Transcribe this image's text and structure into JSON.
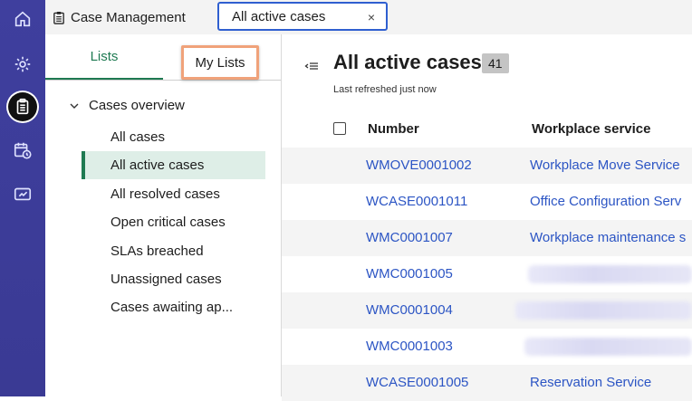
{
  "rail": {
    "items": [
      {
        "name": "home-icon"
      },
      {
        "name": "settings-icon"
      },
      {
        "name": "clipboard-icon",
        "active": true
      },
      {
        "name": "calendar-clock-icon"
      },
      {
        "name": "dashboard-icon"
      }
    ]
  },
  "tabs": {
    "app_label": "Case Management",
    "active_tab_label": "All active cases",
    "close_glyph": "×"
  },
  "sidebar": {
    "tab_lists": "Lists",
    "tab_my_lists": "My Lists",
    "group_label": "Cases overview",
    "items": [
      {
        "label": "All cases"
      },
      {
        "label": "All active cases",
        "selected": true
      },
      {
        "label": "All resolved cases"
      },
      {
        "label": "Open critical cases"
      },
      {
        "label": "SLAs breached"
      },
      {
        "label": "Unassigned cases"
      },
      {
        "label": "Cases awaiting ap..."
      }
    ]
  },
  "main": {
    "title": "All active cases",
    "count": "41",
    "refreshed": "Last refreshed just now",
    "columns": {
      "number": "Number",
      "service": "Workplace service"
    },
    "rows": [
      {
        "number": "WMOVE0001002",
        "service": "Workplace Move Service"
      },
      {
        "number": "WCASE0001011",
        "service": "Office Configuration Serv"
      },
      {
        "number": "WMC0001007",
        "service": "Workplace maintenance s"
      },
      {
        "number": "WMC0001005",
        "service": ""
      },
      {
        "number": "WMC0001004",
        "service": ""
      },
      {
        "number": "WMC0001003",
        "service": ""
      },
      {
        "number": "WCASE0001005",
        "service": "Reservation Service"
      }
    ]
  },
  "colors": {
    "rail": "#3f3f9e",
    "accent_green": "#1f7a52",
    "link_blue": "#2c55c4",
    "highlight_orange": "#f0a27a",
    "tab_border": "#2f5fd0"
  }
}
